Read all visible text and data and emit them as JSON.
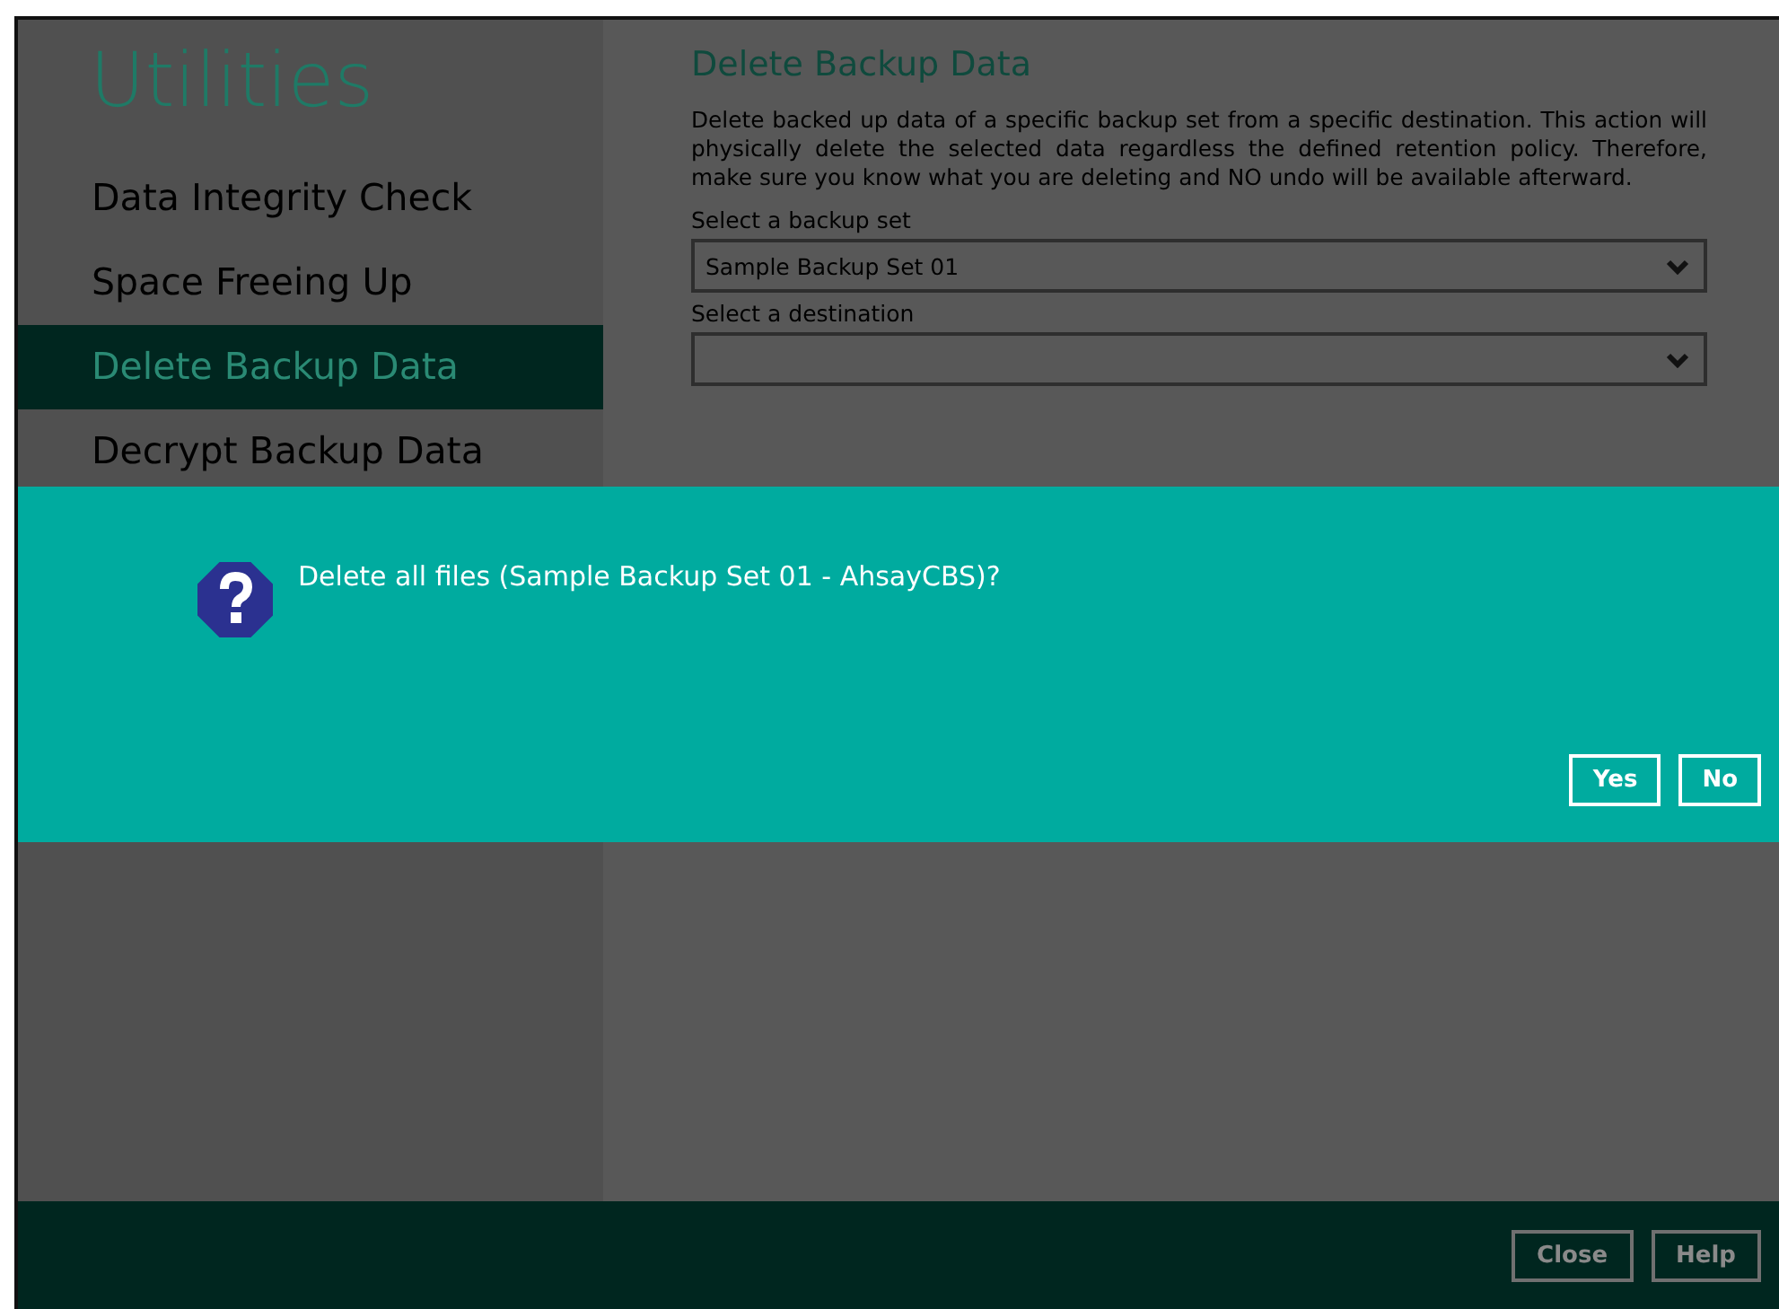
{
  "sidebar": {
    "title": "Utilities",
    "items": [
      {
        "label": "Data Integrity Check",
        "selected": false
      },
      {
        "label": "Space Freeing Up",
        "selected": false
      },
      {
        "label": "Delete Backup Data",
        "selected": true
      },
      {
        "label": "Decrypt Backup Data",
        "selected": false
      }
    ]
  },
  "content": {
    "heading": "Delete Backup Data",
    "description": "Delete backed up data of a specific backup set from a specific destination. This action will physically delete the selected data regardless the defined retention policy. Therefore, make sure you know what you are deleting and NO undo will be available afterward.",
    "fields": [
      {
        "label": "Select a backup set",
        "value": "Sample Backup Set 01"
      },
      {
        "label": "Select a destination"
      }
    ]
  },
  "dialog": {
    "message": "Delete all files (Sample Backup Set 01 - AhsayCBS)?",
    "buttons": [
      "Yes",
      "No"
    ]
  },
  "footer": {
    "buttons": [
      "Close",
      "Help"
    ]
  }
}
